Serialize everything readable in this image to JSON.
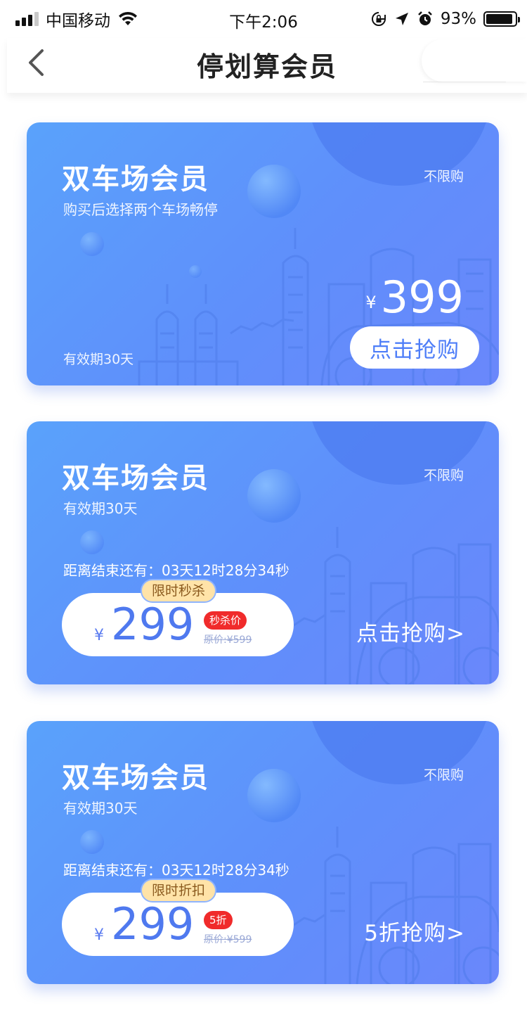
{
  "status_bar": {
    "carrier": "中国移动",
    "time": "下午2:06",
    "battery_percent": "93%",
    "battery_level": 0.93,
    "icons": [
      "signal-icon",
      "wifi-icon",
      "rotation-lock-icon",
      "location-arrow-icon",
      "alarm-icon",
      "battery-icon"
    ]
  },
  "nav": {
    "title": "停划算会员",
    "back_icon": "chevron-left-icon"
  },
  "cards": [
    {
      "title": "双车场会员",
      "subtitle": "购买后选择两个车场畅停",
      "limit": "不限购",
      "validity": "有效期30天",
      "currency": "¥",
      "price": "399",
      "buy_label": "点击抢购"
    },
    {
      "title": "双车场会员",
      "subtitle": "有效期30天",
      "limit": "不限购",
      "countdown": "距离结束还有：03天12时28分34秒",
      "tag": "限时秒杀",
      "currency": "¥",
      "price": "299",
      "badge": "秒杀价",
      "original_price": "原价:¥599",
      "buy_label": "点击抢购>"
    },
    {
      "title": "双车场会员",
      "subtitle": "有效期30天",
      "limit": "不限购",
      "countdown": "距离结束还有：03天12时28分34秒",
      "tag": "限时折扣",
      "currency": "¥",
      "price": "299",
      "badge": "5折",
      "original_price": "原价:¥599",
      "buy_label": "5折抢购>"
    }
  ],
  "colors": {
    "card_gradient_start": "#5aa2fb",
    "card_gradient_end": "#6a87fb",
    "price_text": "#4f79ef",
    "badge_red": "#f02b2b",
    "tag_yellow": "#ffe3a8"
  }
}
